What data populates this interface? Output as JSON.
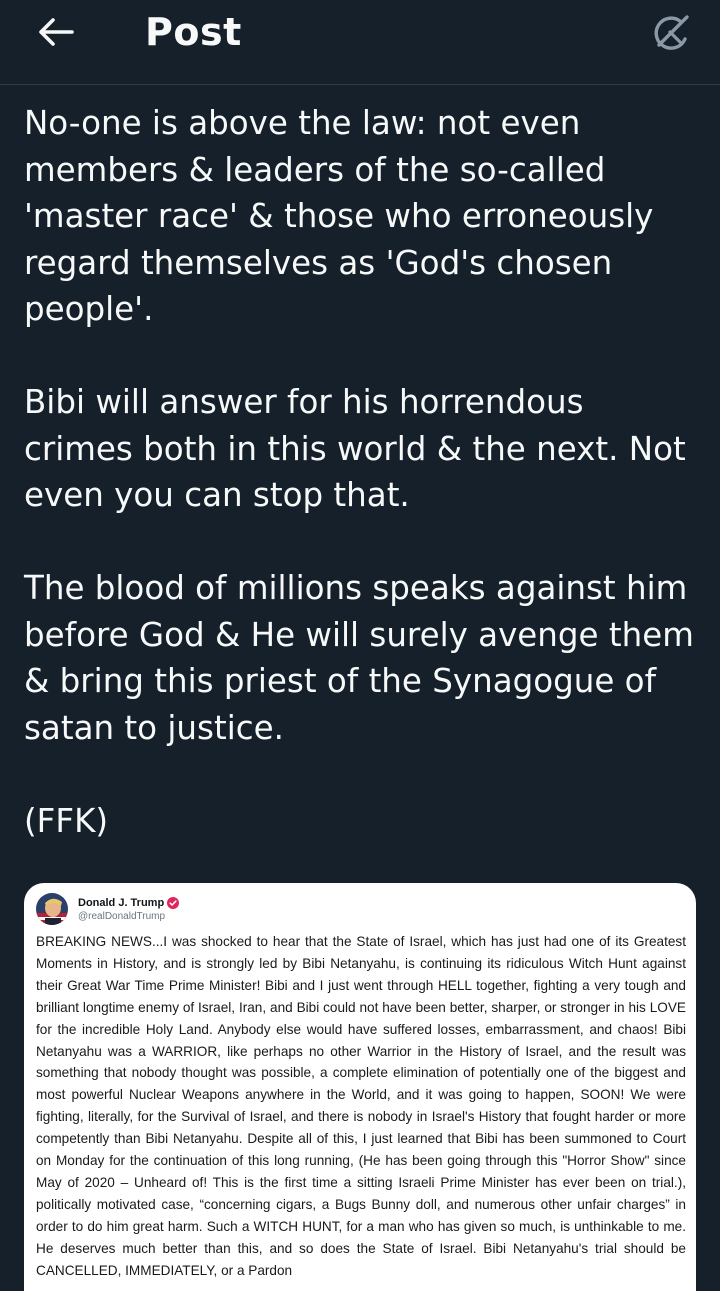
{
  "header": {
    "title": "Post",
    "back_icon": "arrow-left-icon",
    "grok_icon": "grok-icon"
  },
  "post": {
    "paragraphs": [
      "No-one is above the law: not even members & leaders of the so-called 'master race' & those who erroneously regard themselves as 'God's chosen people'.",
      "Bibi will answer for his horrendous crimes both in this world & the next. Not even you can stop that.",
      "The blood of millions speaks against him before God & He will surely avenge them & bring this priest of the Synagogue of satan to justice.",
      "(FFK)"
    ]
  },
  "media": {
    "author_name": "Donald J. Trump",
    "author_handle": "@realDonaldTrump",
    "verified_color": "#e0245e",
    "text": "BREAKING NEWS...I was shocked to hear that the State of Israel, which has just had one of its Greatest Moments in History, and is strongly led by Bibi Netanyahu, is continuing its ridiculous Witch Hunt against their Great War Time Prime Minister! Bibi and I just went through HELL together, fighting a very tough and brilliant longtime enemy of Israel, Iran, and Bibi could not have been better, sharper, or stronger in his LOVE for the incredible Holy Land. Anybody else would have suffered losses, embarrassment, and chaos! Bibi Netanyahu was a WARRIOR, like perhaps no other Warrior in the History of Israel, and the result was something that nobody thought was possible, a complete elimination of potentially one of the biggest and most powerful Nuclear Weapons anywhere in the World, and it was going to happen, SOON! We were fighting, literally, for the Survival of Israel, and there is nobody in Israel's History that fought harder or more competently than Bibi Netanyahu. Despite all of this, I just learned that Bibi has been summoned to Court on Monday for the continuation of this long running, (He has been going through this \"Horror Show\" since May of 2020 – Unheard of! This is the first time a sitting Israeli Prime Minister has ever been on trial.), politically motivated case, “concerning cigars, a Bugs Bunny doll, and numerous other unfair charges” in order to do him great harm. Such a WITCH HUNT, for a man who has given so much, is unthinkable to me. He deserves much better than this, and so does the State of Israel. Bibi Netanyahu's trial should be CANCELLED, IMMEDIATELY, or a Pardon"
  },
  "colors": {
    "background": "#15202b",
    "text": "#f7f9f9",
    "icon": "#8b98a5"
  }
}
